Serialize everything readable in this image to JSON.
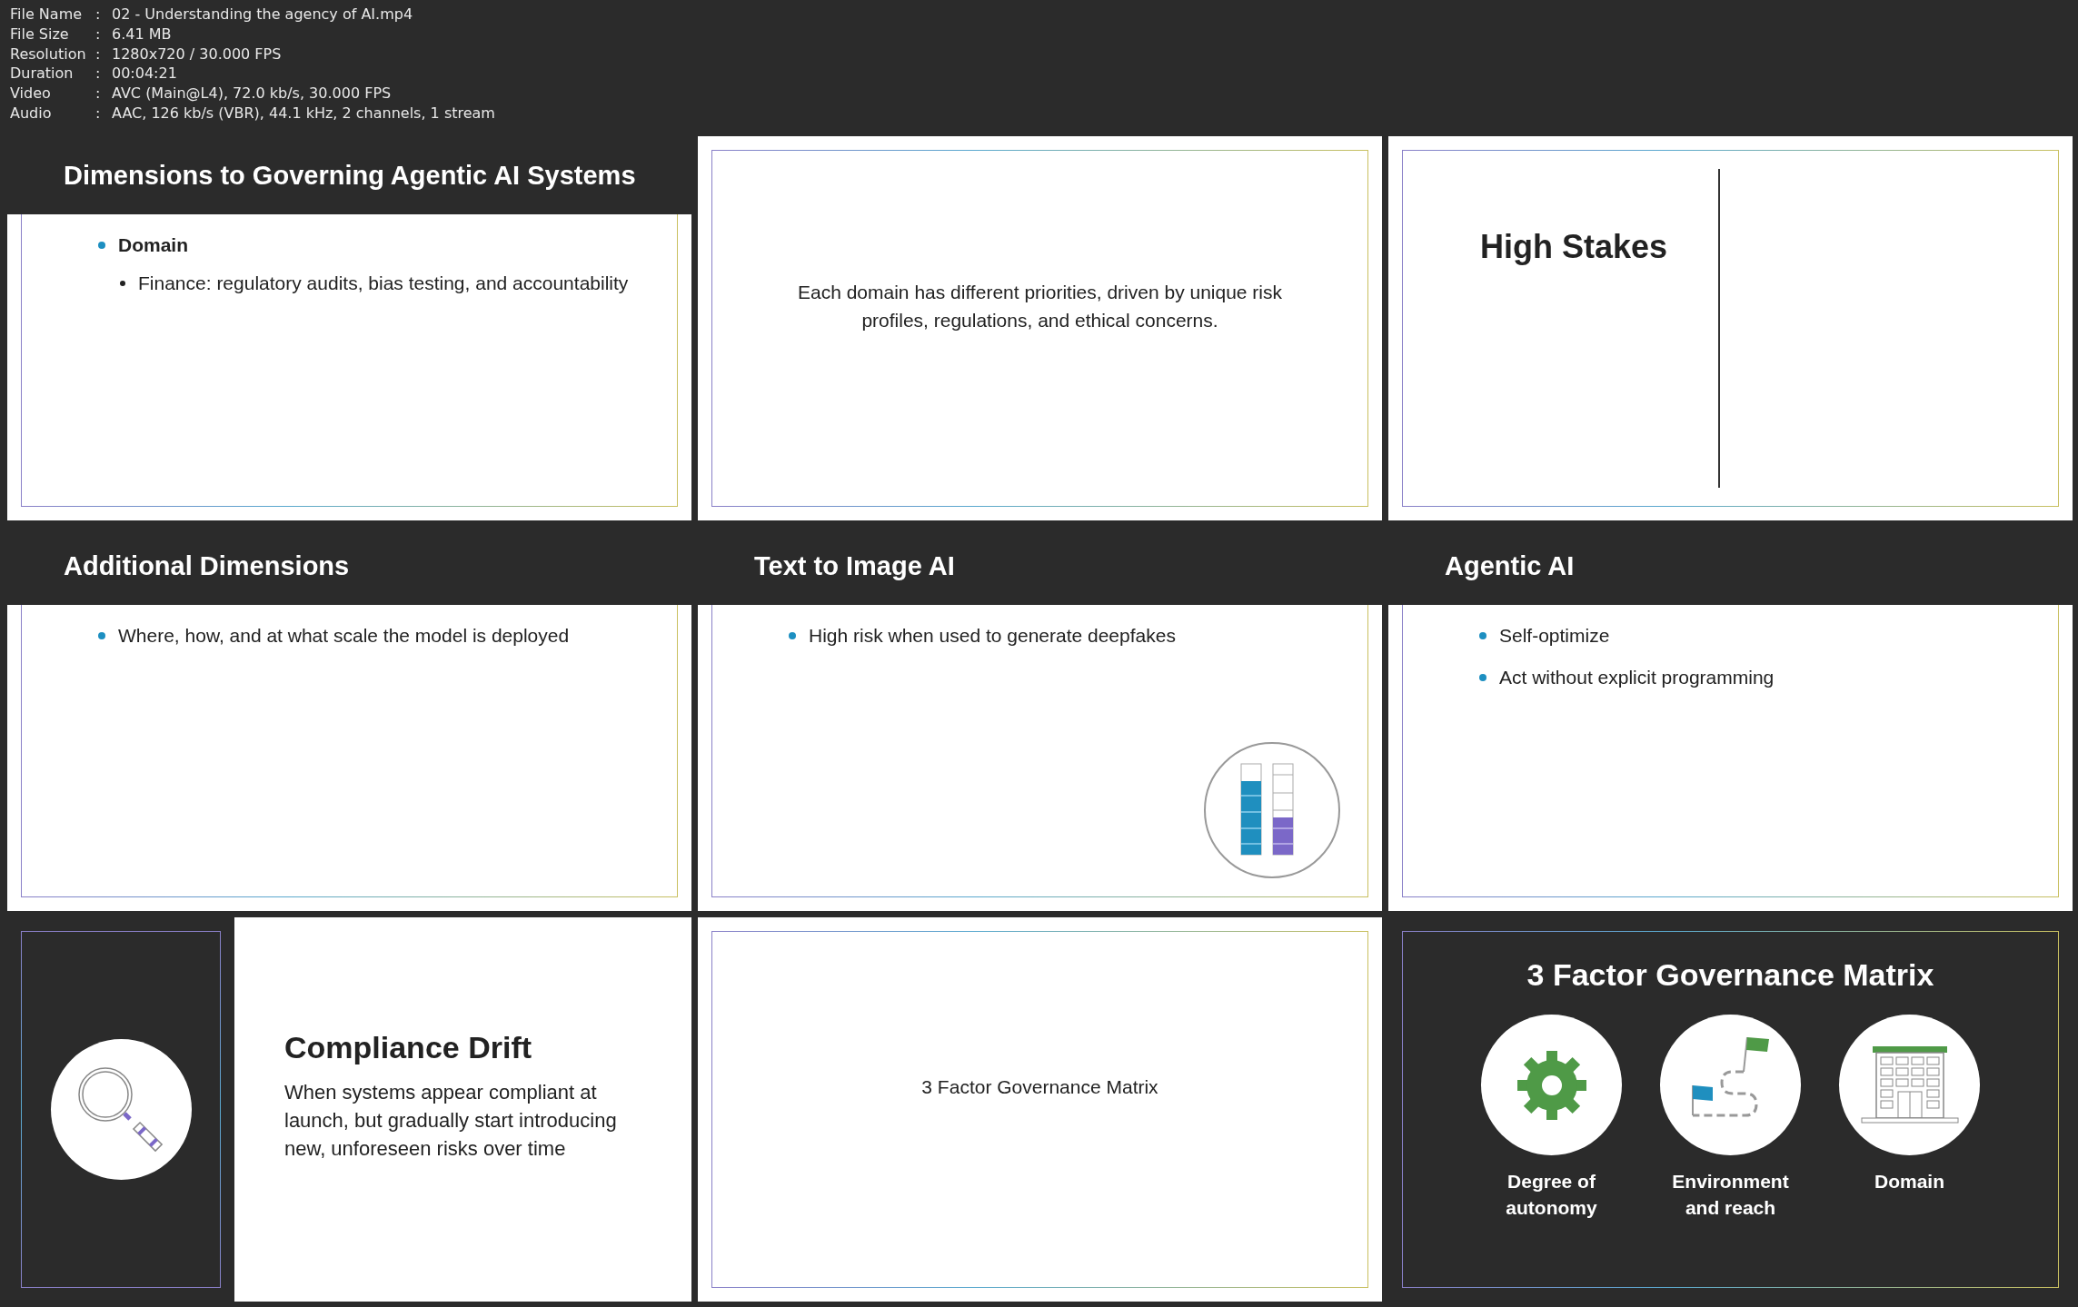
{
  "separator": ":",
  "file_info": [
    {
      "label": "File Name",
      "value": "02 - Understanding the agency of AI.mp4"
    },
    {
      "label": "File Size",
      "value": "6.41 MB"
    },
    {
      "label": "Resolution",
      "value": "1280x720 / 30.000 FPS"
    },
    {
      "label": "Duration",
      "value": "00:04:21"
    },
    {
      "label": "Video",
      "value": "AVC (Main@L4), 72.0 kb/s, 30.000 FPS"
    },
    {
      "label": "Audio",
      "value": "AAC, 126 kb/s (VBR), 44.1 kHz, 2 channels, 1 stream"
    }
  ],
  "frames": [
    {
      "kind": "title_bullets",
      "title": "Dimensions to Governing Agentic AI Systems",
      "bullets": [
        {
          "text": "Domain",
          "bold": true,
          "children": [
            {
              "text": "Finance: regulatory audits, bias testing, and accountability",
              "bold": false
            }
          ]
        }
      ]
    },
    {
      "kind": "centered_text",
      "text": "Each domain has different priorities, driven by unique risk profiles, regulations, and ethical concerns."
    },
    {
      "kind": "divider_title",
      "title": "High Stakes"
    },
    {
      "kind": "title_bullets",
      "title": "Additional Dimensions",
      "bullets": [
        {
          "text": "Where, how, and at what scale the model is deployed",
          "bold": false
        }
      ]
    },
    {
      "kind": "title_bullets",
      "title": "Text to Image AI",
      "bullets": [
        {
          "text": "High risk when used to generate deepfakes",
          "bold": false
        }
      ]
    },
    {
      "kind": "title_bullets",
      "title": "Agentic AI",
      "bullets": [
        {
          "text": "Self-optimize",
          "bold": false
        },
        {
          "text": "Act without explicit programming",
          "bold": false
        }
      ]
    },
    {
      "kind": "icon_text",
      "title": "Compliance Drift",
      "text": "When systems appear compliant at launch, but gradually start introducing new, unforeseen risks over time"
    },
    {
      "kind": "centered_text",
      "text": "3 Factor Governance Matrix"
    },
    {
      "kind": "matrix",
      "title": "3 Factor Governance Matrix",
      "factors": [
        {
          "label": "Degree of autonomy"
        },
        {
          "label": "Environment and reach"
        },
        {
          "label": "Domain"
        }
      ]
    }
  ]
}
